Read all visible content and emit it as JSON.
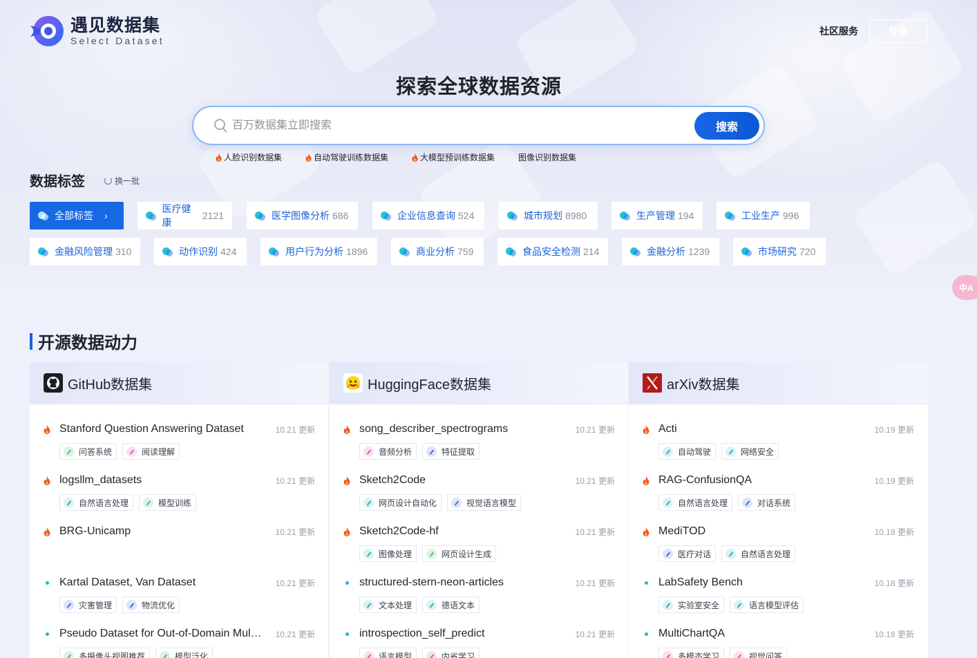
{
  "brand": {
    "name_cn": "遇见数据集",
    "name_en": "Select Dataset"
  },
  "nav": {
    "community": "社区服务",
    "login": "登录"
  },
  "hero": {
    "title": "探索全球数据资源"
  },
  "search": {
    "placeholder": "百万数据集立即搜索",
    "button": "搜索"
  },
  "hot_searches": [
    {
      "label": "人脸识别数据集",
      "hot": true
    },
    {
      "label": "自动驾驶训练数据集",
      "hot": true
    },
    {
      "label": "大模型预训练数据集",
      "hot": true
    },
    {
      "label": "图像识别数据集",
      "hot": false
    }
  ],
  "tags_section": {
    "title": "数据标签",
    "refresh": "换一批"
  },
  "tags": [
    {
      "label": "全部标签",
      "count": "",
      "active": true
    },
    {
      "label": "医疗健康",
      "count": "2121"
    },
    {
      "label": "医学图像分析",
      "count": "686"
    },
    {
      "label": "企业信息查询",
      "count": "524"
    },
    {
      "label": "城市规划",
      "count": "8980"
    },
    {
      "label": "生产管理",
      "count": "194"
    },
    {
      "label": "工业生产",
      "count": "996"
    },
    {
      "label": "金融风险管理",
      "count": "310"
    },
    {
      "label": "动作识别",
      "count": "424"
    },
    {
      "label": "用户行为分析",
      "count": "1896"
    },
    {
      "label": "商业分析",
      "count": "759"
    },
    {
      "label": "食品安全检测",
      "count": "214"
    },
    {
      "label": "金融分析",
      "count": "1239"
    },
    {
      "label": "市场研究",
      "count": "720"
    }
  ],
  "lang_toggle": "中A",
  "section": {
    "title": "开源数据动力"
  },
  "columns": [
    {
      "title": "GitHub数据集",
      "icon": "github-icon",
      "items": [
        {
          "name": "Stanford Question Answering Dataset",
          "date": "10.21 更新",
          "hot": true,
          "tags": [
            [
              "问答系统",
              "green"
            ],
            [
              "阅读理解",
              "pink"
            ]
          ]
        },
        {
          "name": "logsllm_datasets",
          "date": "10.21 更新",
          "hot": true,
          "tags": [
            [
              "自然语言处理",
              "teal"
            ],
            [
              "模型训练",
              "green"
            ]
          ]
        },
        {
          "name": "BRG-Unicamp",
          "date": "10.21 更新",
          "hot": true,
          "tags": []
        },
        {
          "name": "Kartal Dataset, Van Dataset",
          "date": "10.21 更新",
          "hot": false,
          "tags": [
            [
              "灾害管理",
              "blue"
            ],
            [
              "物流优化",
              "blue"
            ]
          ]
        },
        {
          "name": "Pseudo Dataset for Out-of-Domain Multi-Camera View Recommendation",
          "date": "10.21 更新",
          "hot": false,
          "tags": [
            [
              "多摄像头视图推荐",
              "green"
            ],
            [
              "模型泛化",
              "green"
            ]
          ]
        }
      ]
    },
    {
      "title": "HuggingFace数据集",
      "icon": "huggingface-icon",
      "items": [
        {
          "name": "song_describer_spectrograms",
          "date": "10.21 更新",
          "hot": true,
          "tags": [
            [
              "音频分析",
              "pink"
            ],
            [
              "特征提取",
              "blue"
            ]
          ]
        },
        {
          "name": "Sketch2Code",
          "date": "10.21 更新",
          "hot": true,
          "tags": [
            [
              "网页设计自动化",
              "teal"
            ],
            [
              "视觉语言模型",
              "blue"
            ]
          ]
        },
        {
          "name": "Sketch2Code-hf",
          "date": "10.21 更新",
          "hot": true,
          "tags": [
            [
              "图像处理",
              "teal"
            ],
            [
              "网页设计生成",
              "green"
            ]
          ]
        },
        {
          "name": "structured-stern-neon-articles",
          "date": "10.21 更新",
          "hot": false,
          "tags": [
            [
              "文本处理",
              "teal"
            ],
            [
              "德语文本",
              "teal"
            ]
          ]
        },
        {
          "name": "introspection_self_predict",
          "date": "10.21 更新",
          "hot": false,
          "tags": [
            [
              "语言模型",
              "pink"
            ],
            [
              "内省学习",
              "pink"
            ]
          ]
        }
      ]
    },
    {
      "title": "arXiv数据集",
      "icon": "arxiv-icon",
      "items": [
        {
          "name": "Acti",
          "date": "10.19 更新",
          "hot": true,
          "tags": [
            [
              "自动驾驶",
              "teal"
            ],
            [
              "网络安全",
              "teal"
            ]
          ]
        },
        {
          "name": "RAG-ConfusionQA",
          "date": "10.19 更新",
          "hot": true,
          "tags": [
            [
              "自然语言处理",
              "teal"
            ],
            [
              "对话系统",
              "blue"
            ]
          ]
        },
        {
          "name": "MediTOD",
          "date": "10.18 更新",
          "hot": true,
          "tags": [
            [
              "医疗对话",
              "blue"
            ],
            [
              "自然语言处理",
              "teal"
            ]
          ]
        },
        {
          "name": "LabSafety Bench",
          "date": "10.18 更新",
          "hot": false,
          "tags": [
            [
              "实验室安全",
              "teal"
            ],
            [
              "语言模型评估",
              "teal"
            ]
          ]
        },
        {
          "name": "MultiChartQA",
          "date": "10.18 更新",
          "hot": false,
          "tags": [
            [
              "多模态学习",
              "pink"
            ],
            [
              "视觉问答",
              "pink"
            ]
          ]
        }
      ]
    }
  ]
}
